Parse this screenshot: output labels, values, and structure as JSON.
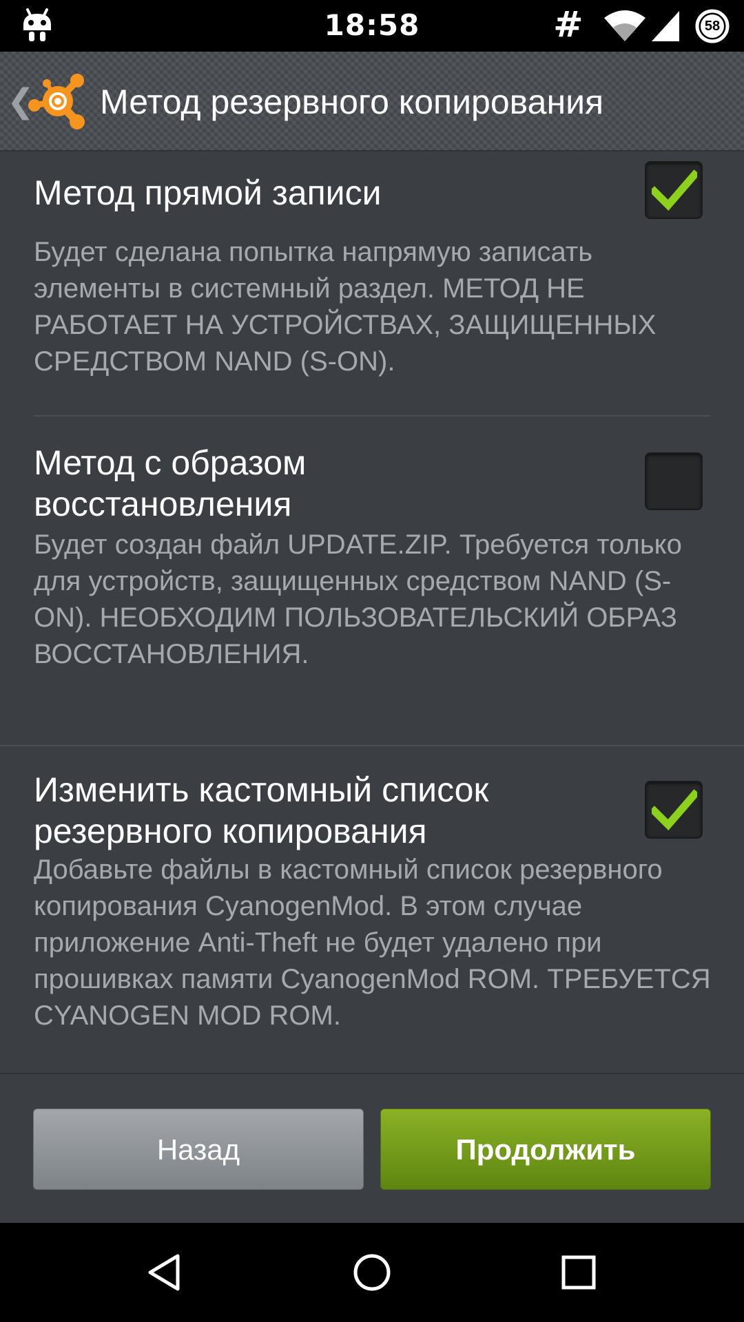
{
  "status_bar": {
    "time": "18:58",
    "hash": "#",
    "battery_level": "58",
    "icons": [
      "cyanogen-android-icon",
      "wifi-icon",
      "signal-icon",
      "battery-icon"
    ]
  },
  "action_bar": {
    "back_chevron": "❮",
    "title": "Метод резервного копирования",
    "logo": "avast-logo-icon"
  },
  "options": [
    {
      "title": "Метод прямой записи",
      "description": "Будет сделана попытка напрямую записать элементы в системный раздел. МЕТОД НЕ РАБОТАЕТ НА УСТРОЙСТВАХ, ЗАЩИЩЕННЫХ СРЕДСТВОМ NAND (S-ON).",
      "checked": true
    },
    {
      "title": "Метод с образом восстановления",
      "description": "Будет создан файл UPDATE.ZIP. Требуется только для устройств, защищенных средством NAND (S-ON). НЕОБХОДИМ ПОЛЬЗОВАТЕЛЬСКИЙ ОБРАЗ ВОССТАНОВЛЕНИЯ.",
      "checked": false
    },
    {
      "title": "Изменить кастомный список резервного копирования",
      "description": "Добавьте файлы в кастомный список резервного копирования CyanogenMod. В этом случае приложение Anti-Theft не будет удалено при прошивках памяти CyanogenMod ROM. ТРЕБУЕТСЯ CYANOGEN MOD ROM.",
      "checked": true
    }
  ],
  "buttons": {
    "back_label": "Назад",
    "continue_label": "Продолжить"
  },
  "colors": {
    "background": "#3b3f44",
    "accent_green": "#7aa31c",
    "check_green": "#8ed11c",
    "avast_orange": "#f7941d"
  }
}
